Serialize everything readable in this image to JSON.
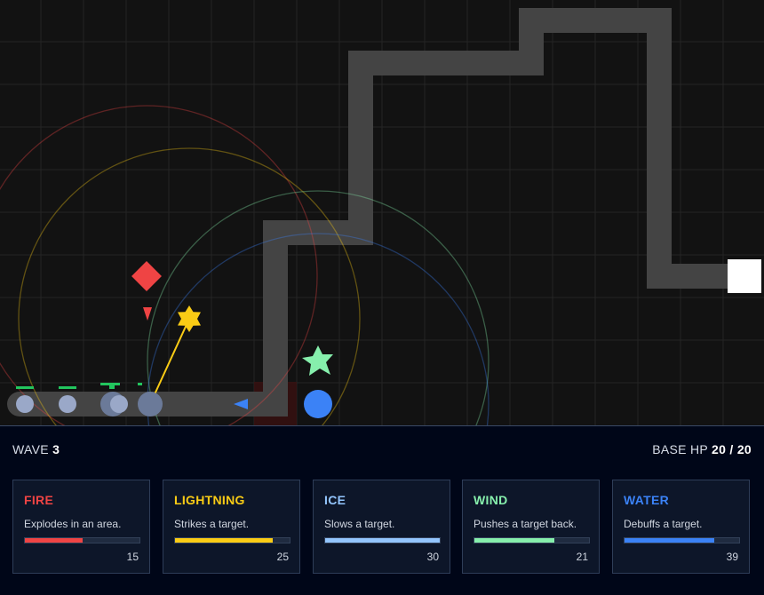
{
  "hud": {
    "wave_label": "WAVE",
    "wave": "3",
    "hp_label": "BASE HP",
    "hp": "20",
    "hp_sep": "/",
    "hp_max": "20"
  },
  "towers": [
    {
      "name": "FIRE",
      "desc": "Explodes in an area.",
      "value": "15",
      "level": 0.5,
      "color": "#ef4444",
      "icon": "fire-diamond-icon"
    },
    {
      "name": "LIGHTNING",
      "desc": "Strikes a target.",
      "value": "25",
      "level": 0.85,
      "color": "#facc15",
      "icon": "lightning-star-icon"
    },
    {
      "name": "ICE",
      "desc": "Slows a target.",
      "value": "30",
      "level": 1.0,
      "color": "#93c5fd",
      "icon": "ice-icon"
    },
    {
      "name": "WIND",
      "desc": "Pushes a target back.",
      "value": "21",
      "level": 0.7,
      "color": "#86efac",
      "icon": "wind-pinwheel-icon"
    },
    {
      "name": "WATER",
      "desc": "Debuffs a target.",
      "value": "39",
      "level": 0.78,
      "color": "#3b82f6",
      "icon": "water-drop-icon"
    }
  ],
  "colors": {
    "board": "#121212",
    "path": "#444444",
    "base": "#ffffff",
    "enemy": "#9aa8c8",
    "hp_bar": "#22c55e"
  }
}
